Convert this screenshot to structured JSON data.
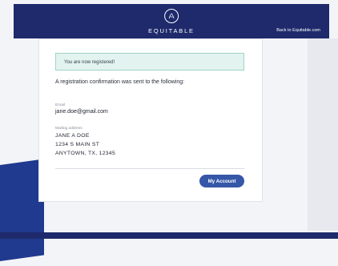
{
  "header": {
    "brand": "EQUITABLE",
    "back_link": "Back to Equitable.com"
  },
  "confirmation": {
    "banner": "You are now registered!",
    "intro": "A registration confirmation was sent to the following:",
    "email_label": "Email",
    "email": "jane.doe@gmail.com",
    "mailing_label": "Mailing address",
    "address_lines": [
      "JANE A DOE",
      "1234 S MAIN ST",
      "ANYTOWN, TX, 12345"
    ]
  },
  "actions": {
    "my_account": "My Account"
  },
  "colors": {
    "header_bg": "#1e2a6b",
    "button_bg": "#3657a8",
    "banner_bg": "#e3f3f0"
  }
}
